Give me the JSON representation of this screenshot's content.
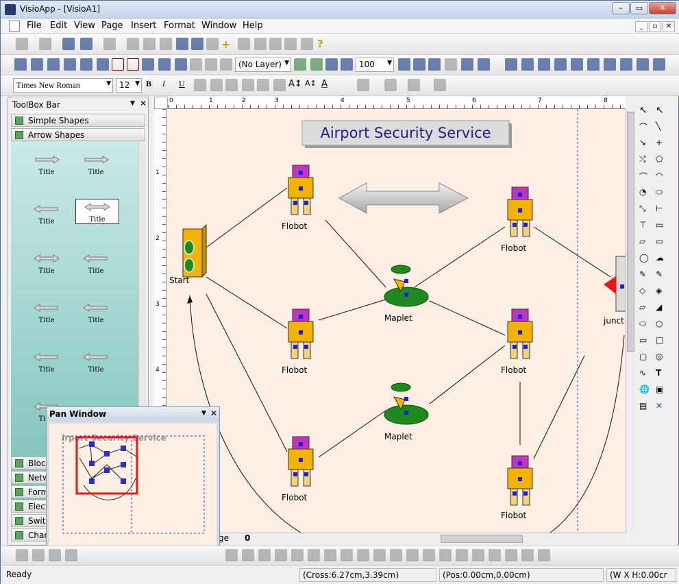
{
  "window": {
    "title": "VisioApp - [VisioA1]"
  },
  "menu": [
    "File",
    "Edit",
    "View",
    "Page",
    "Insert",
    "Format",
    "Window",
    "Help"
  ],
  "toolbar3": {
    "layer": "(No Layer)",
    "zoom": "100"
  },
  "format_toolbar": {
    "font": "Times New Roman",
    "size": "12"
  },
  "toolbox": {
    "title": "ToolBox Bar",
    "sections_top": [
      "Simple Shapes",
      "Arrow Shapes"
    ],
    "shape_label": "Title",
    "sections_bottom": [
      "Block",
      "Netw",
      "Form",
      "Electr",
      "Switc",
      "Chart"
    ]
  },
  "diagram": {
    "title": "Airport Security Service",
    "labels": {
      "start": "Start",
      "flobot": "Flobot",
      "maplet": "Maplet",
      "junction": "junct"
    }
  },
  "pan_window": {
    "title": "Pan Window",
    "thumb_title": "irport Security Service"
  },
  "page_tab": {
    "label": "ge",
    "number": "0"
  },
  "ruler": {
    "h_ticks": [
      "0",
      "1",
      "2",
      "3",
      "4",
      "5",
      "6",
      "7",
      "8"
    ],
    "v_ticks": [
      "1",
      "2",
      "3",
      "4"
    ]
  },
  "status": {
    "ready": "Ready",
    "cross": "(Cross:6.27cm,3.39cm)",
    "pos": "(Pos:0.00cm,0.00cm)",
    "size": "(W X H:0.00cr"
  }
}
